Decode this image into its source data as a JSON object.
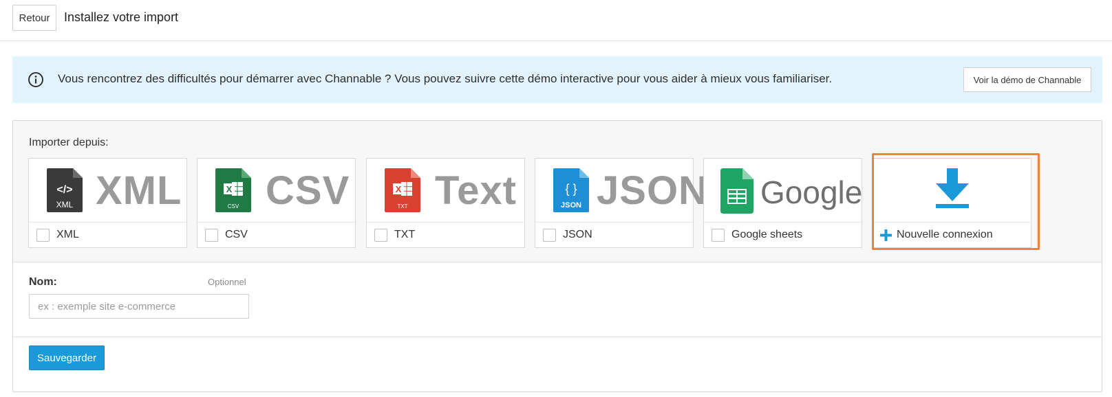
{
  "header": {
    "back_label": "Retour",
    "title": "Installez votre import"
  },
  "banner": {
    "icon": "info-icon",
    "text": "Vous rencontrez des difficultés pour démarrer avec Channable ? Vous pouvez suivre cette démo interactive pour vous aider à mieux vous familiariser.",
    "demo_button": "Voir la démo de Channable",
    "background": "#e3f3fc"
  },
  "import": {
    "label": "Importer depuis:",
    "options": [
      {
        "label": "XML",
        "logo_text": "XML",
        "icon_text": "XML",
        "icon_glyph": "</>",
        "icon": "xml-file-icon",
        "color": "#3a3a3a"
      },
      {
        "label": "CSV",
        "logo_text": "CSV",
        "icon_text": "CSV",
        "icon_glyph": "X",
        "icon": "csv-file-icon",
        "color": "#1f7a44"
      },
      {
        "label": "TXT",
        "logo_text": "Text",
        "icon_text": "TXT",
        "icon_glyph": "X",
        "icon": "txt-file-icon",
        "color": "#d8412f"
      },
      {
        "label": "JSON",
        "logo_text": "JSON",
        "icon_text": "JSON",
        "icon_glyph": "{ }",
        "icon": "json-file-icon",
        "color": "#1e8fd6"
      },
      {
        "label": "Google sheets",
        "logo_text": "Google",
        "icon": "google-sheets-icon",
        "color": "#1fa463"
      }
    ],
    "new_connection": {
      "label": "Nouvelle connexion",
      "icon": "download-icon",
      "plus_icon": "plus-icon",
      "color": "#1a9ad9",
      "highlight": "#e8843d"
    }
  },
  "name": {
    "label": "Nom:",
    "optional": "Optionnel",
    "placeholder": "ex : exemple site e-commerce",
    "value": ""
  },
  "save_label": "Sauvegarder"
}
